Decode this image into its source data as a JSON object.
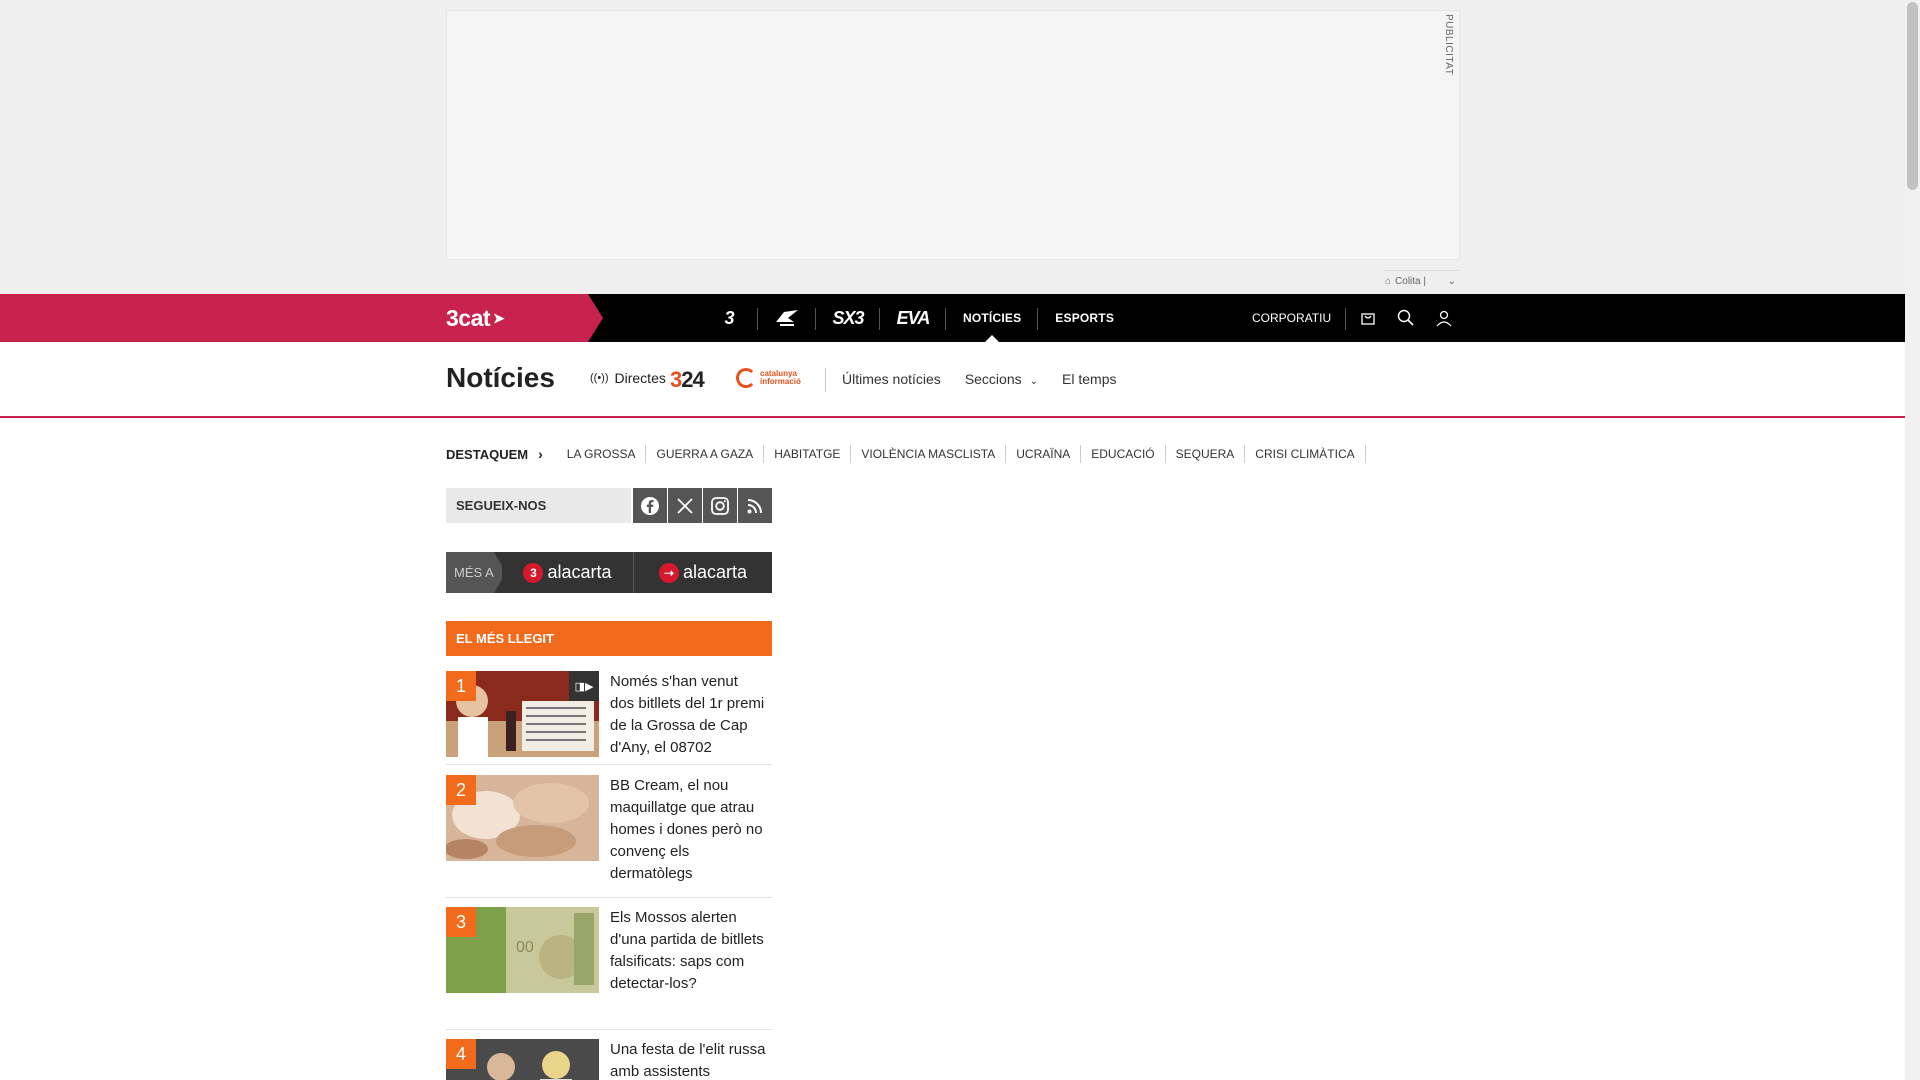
{
  "ad": {
    "label": "PUBLICITAT",
    "colita": "Colita |"
  },
  "topbar": {
    "brand": "3cat",
    "channels": [
      {
        "label": "3",
        "name": "tv3"
      },
      {
        "label": "cr",
        "name": "catradio"
      },
      {
        "label": "SX3",
        "name": "sx3"
      },
      {
        "label": "EVA",
        "name": "eva"
      }
    ],
    "noticies": "NOTÍCIES",
    "esports": "ESPORTS",
    "corporatiu": "CORPORATIU",
    "icons": [
      "bag-icon",
      "search-icon",
      "user-icon"
    ]
  },
  "section": {
    "title": "Notícies",
    "directes": "Directes",
    "logo324_a": "3",
    "logo324_b": "24",
    "logoCI": "catalunya informació",
    "nav": {
      "ultimes": "Últimes notícies",
      "seccions": "Seccions",
      "temps": "El temps"
    }
  },
  "destaquem": {
    "label": "DESTAQUEM",
    "tags": [
      "LA GROSSA",
      "GUERRA A GAZA",
      "HABITATGE",
      "VIOLÈNCIA MASCLISTA",
      "UCRAÏNA",
      "EDUCACIÓ",
      "SEQUERA",
      "CRISI CLIMÀTICA"
    ]
  },
  "follow": {
    "label": "SEGUEIX-NOS",
    "networks": [
      "facebook-icon",
      "x-icon",
      "instagram-icon",
      "rss-icon"
    ]
  },
  "alacarta": {
    "mes": "MÉS A",
    "tv3": "alacarta",
    "radio": "alacarta"
  },
  "mostread": {
    "title": "EL MÉS LLEGIT",
    "items": [
      {
        "num": "1",
        "text": "Només s'han venut dos bitllets del 1r premi de la Grossa de Cap d'Any, el 08702",
        "video": true
      },
      {
        "num": "2",
        "text": "BB Cream, el nou maquillatge que atrau homes i dones però no convenç els dermatòlegs",
        "video": false
      },
      {
        "num": "3",
        "text": "Els Mossos alerten d'una partida de bitllets falsificats: saps com detectar-los?",
        "video": false
      },
      {
        "num": "4",
        "text": "Una festa de l'elit russa amb assistents",
        "video": false
      }
    ]
  },
  "colors": {
    "brand": "#c8234f",
    "accent": "#f26b1d",
    "bar": "#000000"
  }
}
